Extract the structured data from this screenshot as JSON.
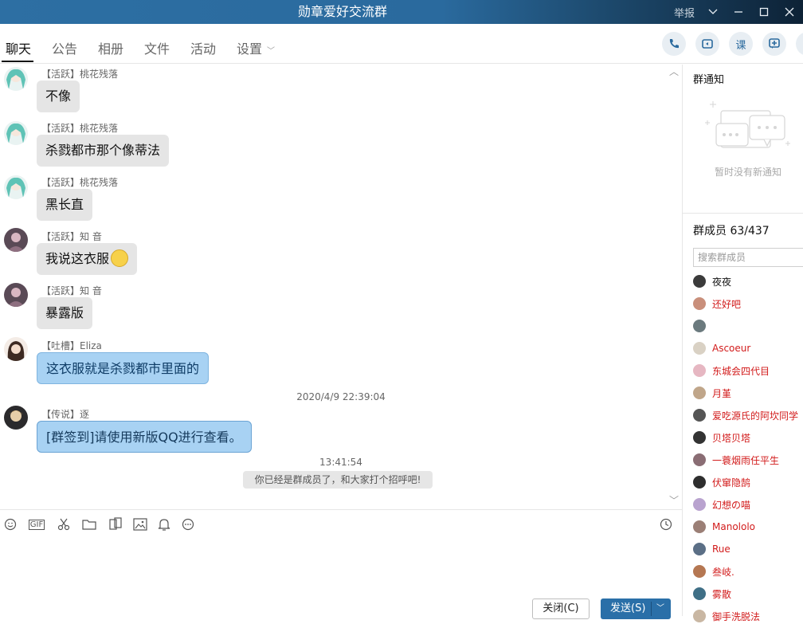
{
  "window": {
    "title": "勋章爱好交流群",
    "report_label": "举报"
  },
  "tabs": [
    {
      "label": "聊天"
    },
    {
      "label": "公告"
    },
    {
      "label": "相册"
    },
    {
      "label": "文件"
    },
    {
      "label": "活动"
    },
    {
      "label": "设置"
    }
  ],
  "toolbar_right": {
    "lesson_glyph": "课"
  },
  "messages": [
    {
      "sender": "【活跃】桃花残落",
      "text": "不像",
      "style": "gray"
    },
    {
      "sender": "【活跃】桃花残落",
      "text": "杀戮都市那个像蒂法",
      "style": "gray"
    },
    {
      "sender": "【活跃】桃花残落",
      "text": "黑长直",
      "style": "gray"
    },
    {
      "sender": "【活跃】知 音",
      "text": "我说这衣服",
      "style": "gray"
    },
    {
      "sender": "【活跃】知 音",
      "text": "暴露版",
      "style": "gray"
    },
    {
      "sender": "【吐槽】Eliza",
      "text": "这衣服就是杀戮都市里面的",
      "style": "blue"
    },
    {
      "sender": "【传说】逐",
      "text": "[群签到]请使用新版QQ进行查看。",
      "style": "blue"
    }
  ],
  "timestamps": {
    "first": "2020/4/9 22:39:04",
    "second": "13:41:54"
  },
  "system_note": "你已经是群成员了，和大家打个招呼吧!",
  "input_toolbar": {
    "gif_label": "GIF"
  },
  "buttons": {
    "close_label": "关闭(C)",
    "send_label": "发送(S)"
  },
  "panel": {
    "notice_title": "群通知",
    "notice_empty": "暂时没有新通知",
    "members_title": "群成员 63/437",
    "search_placeholder": "搜索群成员",
    "members": [
      {
        "name": "夜夜",
        "color": "#111111"
      },
      {
        "name": "还好吧",
        "color": "#d21b1b"
      },
      {
        "name": "",
        "color": "#111111"
      },
      {
        "name": "Ascoeur",
        "color": "#d21b1b"
      },
      {
        "name": "东城会四代目",
        "color": "#d21b1b"
      },
      {
        "name": "月堇",
        "color": "#d21b1b"
      },
      {
        "name": "爱吃源氏的阿坎同学",
        "color": "#d21b1b"
      },
      {
        "name": "贝塔贝塔",
        "color": "#d21b1b"
      },
      {
        "name": "一蓑烟雨任平生",
        "color": "#d21b1b"
      },
      {
        "name": "伏窜隐鹄",
        "color": "#d21b1b"
      },
      {
        "name": "幻想の喵",
        "color": "#d21b1b"
      },
      {
        "name": "Manololo",
        "color": "#d21b1b"
      },
      {
        "name": "Rue",
        "color": "#d21b1b"
      },
      {
        "name": "叁岐.",
        "color": "#d21b1b"
      },
      {
        "name": "雾散",
        "color": "#d21b1b"
      },
      {
        "name": "御手洗脱法",
        "color": "#d21b1b"
      }
    ]
  }
}
